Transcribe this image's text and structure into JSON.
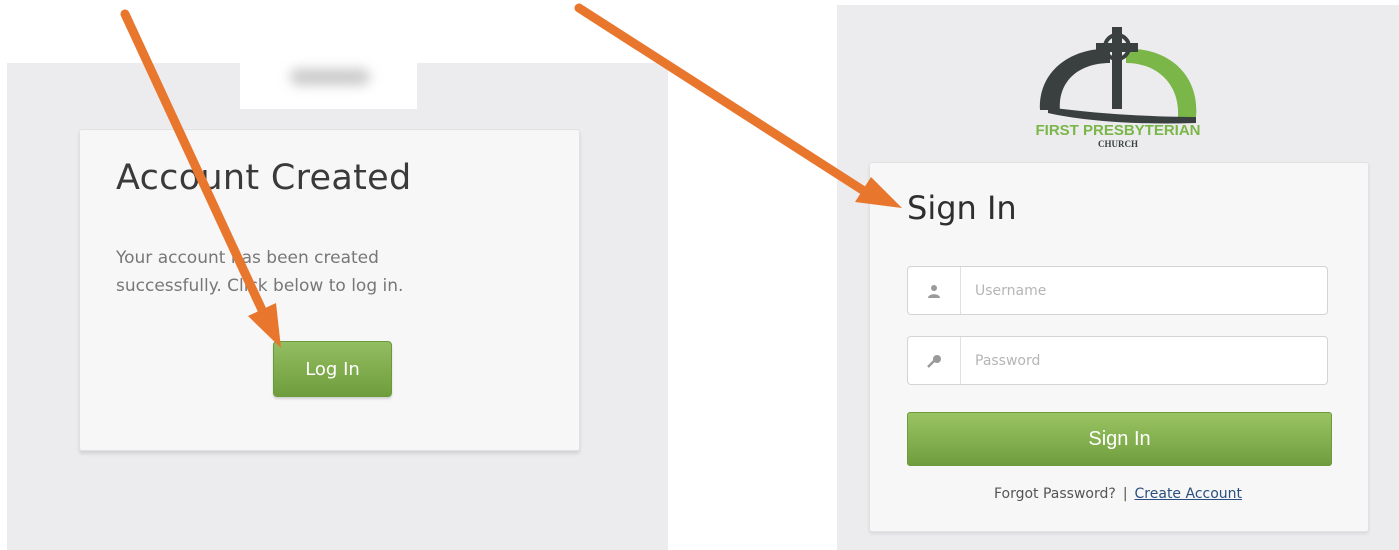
{
  "left": {
    "title": "Account Created",
    "message": "Your account has been created successfully. Click below to log in.",
    "login_label": "Log In"
  },
  "right": {
    "logo_text": "FIRST PRESBYTERIAN",
    "logo_subtext": "CHURCH",
    "title": "Sign In",
    "username_placeholder": "Username",
    "password_placeholder": "Password",
    "signin_label": "Sign In",
    "forgot_label": "Forgot Password?",
    "separator": "|",
    "create_label": "Create Account"
  },
  "colors": {
    "arrow": "#e8762d",
    "button_green": "#7aa84a",
    "logo_dark": "#3a3f3f",
    "logo_green": "#7ab648"
  },
  "icons": {
    "username": "user-icon",
    "password": "key-icon",
    "annotation": "arrow-icon"
  }
}
